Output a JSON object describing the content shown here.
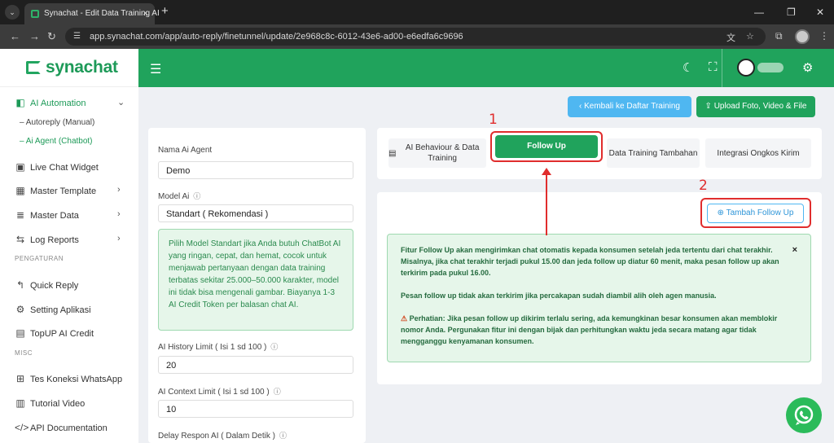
{
  "browser": {
    "tab_title": "Synachat - Edit Data Training AI",
    "url": "app.synachat.com/app/auto-reply/finetunnel/update/2e968c8c-6012-43e6-ad00-e6edfa6c9696"
  },
  "app": {
    "logo": "synachat"
  },
  "sidebar": {
    "items": [
      {
        "label": "AI Automation",
        "icon": "robot-icon"
      },
      {
        "label": "Autoreply (Manual)"
      },
      {
        "label": "Ai Agent (Chatbot)"
      },
      {
        "label": "Live Chat Widget",
        "icon": "chat-window-icon"
      },
      {
        "label": "Master Template",
        "icon": "grid-icon"
      },
      {
        "label": "Master Data",
        "icon": "list-icon"
      },
      {
        "label": "Log Reports",
        "icon": "log-icon"
      }
    ],
    "section_pengaturan": "PENGATURAN",
    "pengaturan_items": [
      {
        "label": "Quick Reply",
        "icon": "reply-icon"
      },
      {
        "label": "Setting Aplikasi",
        "icon": "gear-icon"
      },
      {
        "label": "TopUP AI Credit",
        "icon": "wallet-icon"
      }
    ],
    "section_misc": "MISC",
    "misc_items": [
      {
        "label": "Tes Koneksi WhatsApp",
        "icon": "plus-square-icon"
      },
      {
        "label": "Tutorial Video",
        "icon": "book-icon"
      },
      {
        "label": "API Documentation",
        "icon": "code-icon"
      }
    ]
  },
  "actions": {
    "back_label": "Kembali ke Daftar Training",
    "upload_label": "Upload Foto, Video & File"
  },
  "form": {
    "agent_name_label": "Nama Ai Agent",
    "agent_name_value": "Demo",
    "model_label": "Model Ai",
    "model_value": "Standart ( Rekomendasi )",
    "model_note": "Pilih Model Standart jika Anda butuh ChatBot AI yang ringan, cepat, dan hemat, cocok untuk menjawab pertanyaan dengan data training terbatas sekitar 25.000–50.000 karakter, model ini tidak bisa mengenali gambar. Biayanya 1-3 AI Credit Token per balasan chat AI.",
    "history_label": "AI History Limit ( Isi 1 sd 100 )",
    "history_value": "20",
    "context_label": "AI Context Limit ( Isi 1 sd 100 )",
    "context_value": "10",
    "delay_label": "Delay Respon AI ( Dalam Detik )"
  },
  "tabs": [
    {
      "label": "AI Behaviour & Data Training"
    },
    {
      "label": "Follow Up"
    },
    {
      "label": "Data Training Tambahan"
    },
    {
      "label": "Integrasi Ongkos Kirim"
    }
  ],
  "followup": {
    "add_label": "Tambah Follow Up",
    "info_p1": "Fitur Follow Up akan mengirimkan chat otomatis kepada konsumen setelah jeda tertentu dari chat terakhir. Misalnya, jika chat terakhir terjadi pukul 15.00 dan jeda follow up diatur 60 menit, maka pesan follow up akan terkirim pada pukul 16.00.",
    "info_p2": "Pesan follow up tidak akan terkirim jika percakapan sudah diambil alih oleh agen manusia.",
    "info_p3": "Perhatian: Jika pesan follow up dikirim terlalu sering, ada kemungkinan besar konsumen akan memblokir nomor Anda. Pergunakan fitur ini dengan bijak dan perhitungkan waktu jeda secara matang agar tidak mengganggu kenyamanan konsumen."
  },
  "annotations": {
    "num1": "1",
    "num2": "2"
  },
  "colors": {
    "primary_green": "#20a35c",
    "accent_blue": "#4fb7f1",
    "annotation_red": "#e02d2d"
  }
}
